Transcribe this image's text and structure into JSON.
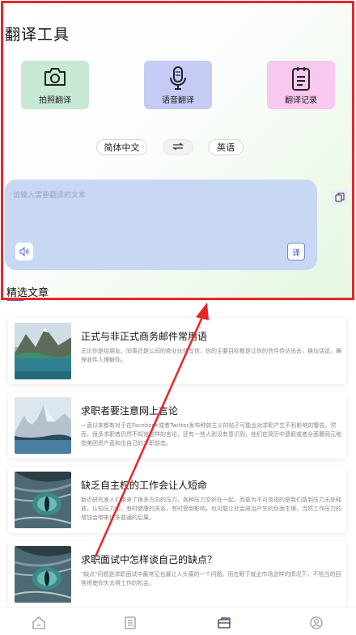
{
  "header": {
    "title": "翻译工具"
  },
  "tools": [
    {
      "label": "拍照翻译",
      "icon": "camera-icon",
      "bg": "#c8e9d4"
    },
    {
      "label": "语音翻译",
      "icon": "microphone-icon",
      "bg": "#c5cbf4"
    },
    {
      "label": "翻译记录",
      "icon": "clipboard-icon",
      "bg": "#f8c8ee"
    }
  ],
  "languages": {
    "source": "简体中文",
    "swap_icon": "swap-arrows-icon",
    "target": "英语"
  },
  "input": {
    "placeholder": "请输入需要翻译的文本",
    "translate_label": "译",
    "speaker_icon": "speaker-icon",
    "copy_icon": "copy-icon"
  },
  "section": {
    "title": "精选文章",
    "accent": "#5b63c8"
  },
  "articles": [
    {
      "title": "正式与非正式商务邮件常用语",
      "desc": "无论你是给朋友、同事还是公司的商业伙伴写信，你的主要目标都是让你的信件传达出去，换句话说，确保收件人理解你。",
      "thumb": "lake-mountains"
    },
    {
      "title": "求职者要注意网上言论",
      "desc": "一直以来都有对于在Facebook或者Twitter发布种族主义的帖子可能会对求职产生不利影响的警告。然而，很多求职者仍然不知道这样的言论，还有一些人则没有意识到，他们在简历中遗假或者全面篡网元地指美团资产直和出自己的求职前态。",
      "thumb": "snow-lake"
    },
    {
      "title": "缺乏自主权的工作会让人短命",
      "desc": "新近研究发人们带来了很多方向的压力，各种压力交织在一起，而更为不可忽视的是我们感到压力无处释放，认知压力中，有时健康的关系，有时受到影响，也可能让社会政治产生的负面生理，当然工作压力的增加会带来许多普通的后果。",
      "thumb": "cat-eye"
    },
    {
      "title": "求职面试中怎样谈自己的缺点？",
      "desc": "\"缺点\"问题是求职面试中最常见也最让人头痛的一个问题。而在眼下就业市场这样的情况下，不恰当的回答将使你失去得工作的机会。",
      "thumb": "cat-eye"
    }
  ],
  "tabbar": {
    "items": [
      {
        "icon": "home-icon"
      },
      {
        "icon": "document-icon"
      },
      {
        "icon": "briefcase-icon"
      },
      {
        "icon": "user-icon"
      }
    ]
  },
  "annotation": {
    "color": "#e8262a"
  }
}
